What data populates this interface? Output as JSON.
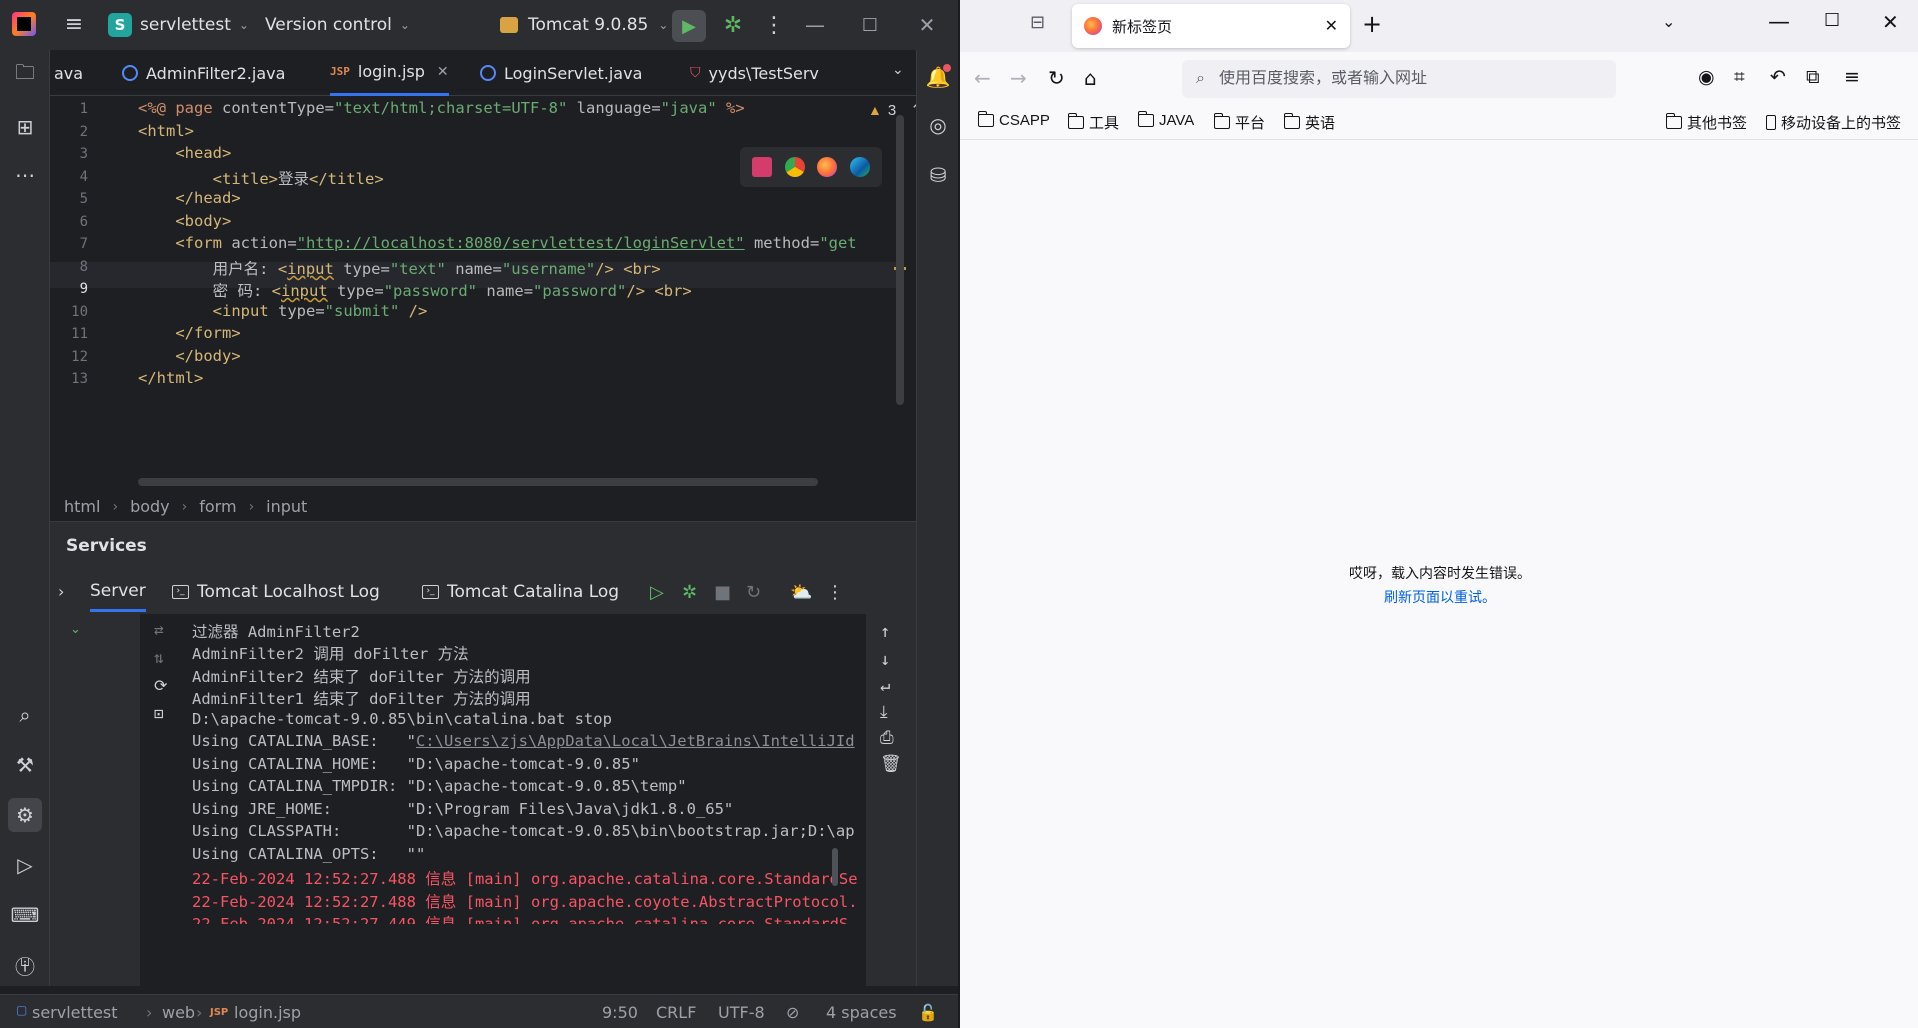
{
  "ide": {
    "project_name": "servlettest",
    "project_badge": "S",
    "vcs_label": "Version control",
    "run_config": "Tomcat 9.0.85",
    "editor_tabs": [
      {
        "label": "ava",
        "type": "class"
      },
      {
        "label": "AdminFilter2.java",
        "type": "class"
      },
      {
        "label": "login.jsp",
        "type": "jsp",
        "active": true
      },
      {
        "label": "LoginServlet.java",
        "type": "class"
      },
      {
        "label": "yyds\\TestServ",
        "type": "test"
      }
    ],
    "inspection_count": "3",
    "code": {
      "line_numbers": [
        "1",
        "2",
        "3",
        "4",
        "5",
        "6",
        "7",
        "8",
        "9",
        "10",
        "11",
        "12",
        "13"
      ],
      "current_line": 9
    },
    "breadcrumb": [
      "html",
      "body",
      "form",
      "input"
    ],
    "services": {
      "title": "Services",
      "tabs": [
        "Server",
        "Tomcat Localhost Log",
        "Tomcat Catalina Log"
      ],
      "console": [
        "过滤器 AdminFilter2",
        "AdminFilter2 调用 doFilter 方法",
        "AdminFilter2 结束了 doFilter 方法的调用",
        "AdminFilter1 结束了 doFilter 方法的调用",
        "D:\\apache-tomcat-9.0.85\\bin\\catalina.bat stop",
        "Using CATALINA_BASE:   \"",
        "C:\\Users\\zjs\\AppData\\Local\\JetBrains\\IntelliJId",
        "Using CATALINA_HOME:   \"D:\\apache-tomcat-9.0.85\"",
        "Using CATALINA_TMPDIR: \"D:\\apache-tomcat-9.0.85\\temp\"",
        "Using JRE_HOME:        \"D:\\Program Files\\Java\\jdk1.8.0_65\"",
        "Using CLASSPATH:       \"D:\\apache-tomcat-9.0.85\\bin\\bootstrap.jar;D:\\ap",
        "Using CATALINA_OPTS:   \"\"",
        "22-Feb-2024 12:52:27.488 信息 [main] org.apache.catalina.core.StandardSe",
        "22-Feb-2024 12:52:27.488 信息 [main] org.apache.coyote.AbstractProtocol.",
        "22-Feb-2024 12:52:27.449 信息 [main] org.apache.catalina.core.StandardS"
      ]
    },
    "statusbar": {
      "path": [
        "servlettest",
        "web",
        "login.jsp"
      ],
      "position": "9:50",
      "line_sep": "CRLF",
      "encoding": "UTF-8",
      "indent": "4 spaces"
    }
  },
  "browser": {
    "tab_title": "新标签页",
    "url_placeholder": "使用百度搜索，或者输入网址",
    "bookmarks": [
      "CSAPP",
      "工具",
      "JAVA",
      "平台",
      "英语"
    ],
    "other_bookmarks": "其他书签",
    "mobile_bookmarks": "移动设备上的书签",
    "error_message": "哎呀，载入内容时发生错误。",
    "retry_link": "刷新页面以重试。"
  },
  "colors": {
    "ide_bg": "#1e1f22",
    "ide_panel": "#2b2d30",
    "accent": "#3574f0",
    "run_green": "#5fb865",
    "log_red": "#f75464",
    "browser_bg": "#f9f9fb",
    "link_blue": "#0061e0"
  }
}
